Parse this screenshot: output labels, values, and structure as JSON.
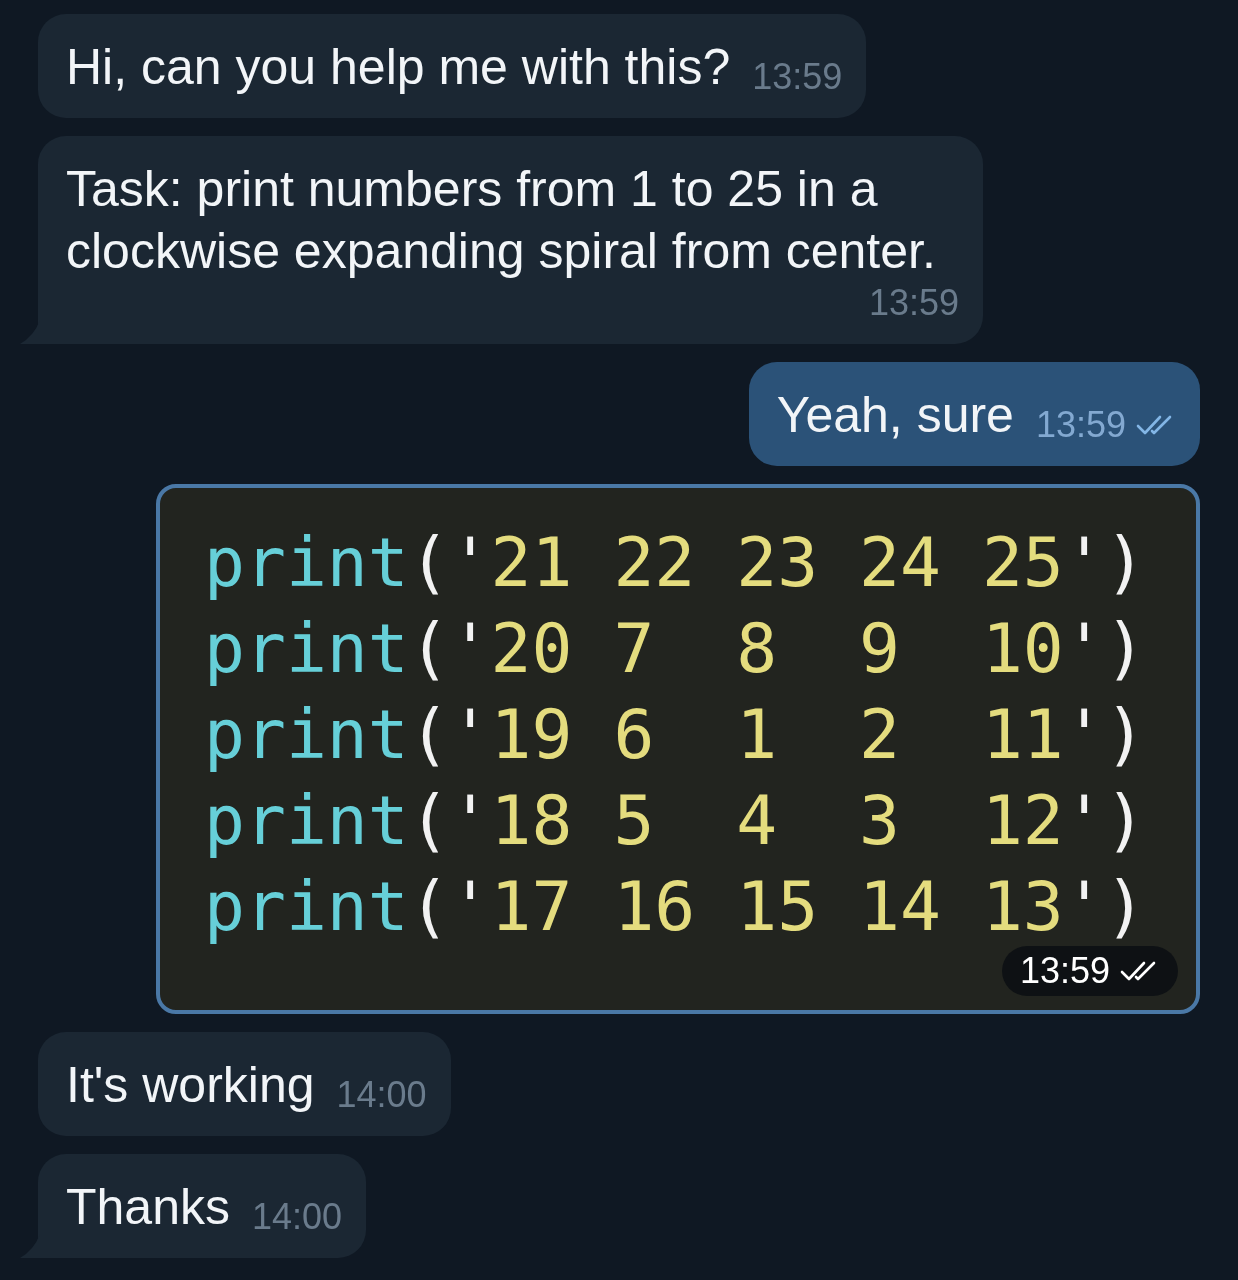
{
  "messages": [
    {
      "kind": "text",
      "outgoing": false,
      "text": "Hi, can you help me with this?",
      "time": "13:59",
      "tail": false
    },
    {
      "kind": "text",
      "outgoing": false,
      "text": "Task: print numbers from 1 to 25 in a clockwise expanding spiral from center.",
      "time": "13:59",
      "tail": true
    },
    {
      "kind": "text",
      "outgoing": true,
      "text": "Yeah, sure",
      "time": "13:59",
      "read": true,
      "tail": false
    },
    {
      "kind": "code",
      "outgoing": true,
      "time": "13:59",
      "read": true,
      "lines": [
        [
          {
            "text": "print",
            "kind": "function"
          },
          {
            "text": "(",
            "kind": "punct"
          },
          {
            "text": "'",
            "kind": "punct"
          },
          {
            "text": "21 22 23 24 25",
            "kind": "string"
          },
          {
            "text": "'",
            "kind": "punct"
          },
          {
            "text": ")",
            "kind": "punct"
          }
        ],
        [
          {
            "text": "print",
            "kind": "function"
          },
          {
            "text": "(",
            "kind": "punct"
          },
          {
            "text": "'",
            "kind": "punct"
          },
          {
            "text": "20 7  8  9  10",
            "kind": "string"
          },
          {
            "text": "'",
            "kind": "punct"
          },
          {
            "text": ")",
            "kind": "punct"
          }
        ],
        [
          {
            "text": "print",
            "kind": "function"
          },
          {
            "text": "(",
            "kind": "punct"
          },
          {
            "text": "'",
            "kind": "punct"
          },
          {
            "text": "19 6  1  2  11",
            "kind": "string"
          },
          {
            "text": "'",
            "kind": "punct"
          },
          {
            "text": ")",
            "kind": "punct"
          }
        ],
        [
          {
            "text": "print",
            "kind": "function"
          },
          {
            "text": "(",
            "kind": "punct"
          },
          {
            "text": "'",
            "kind": "punct"
          },
          {
            "text": "18 5  4  3  12",
            "kind": "string"
          },
          {
            "text": "'",
            "kind": "punct"
          },
          {
            "text": ")",
            "kind": "punct"
          }
        ],
        [
          {
            "text": "print",
            "kind": "function"
          },
          {
            "text": "(",
            "kind": "punct"
          },
          {
            "text": "'",
            "kind": "punct"
          },
          {
            "text": "17 16 15 14 13",
            "kind": "string"
          },
          {
            "text": "'",
            "kind": "punct"
          },
          {
            "text": ")",
            "kind": "punct"
          }
        ]
      ]
    },
    {
      "kind": "text",
      "outgoing": false,
      "text": "It's working",
      "time": "14:00",
      "tail": false
    },
    {
      "kind": "text",
      "outgoing": false,
      "text": "Thanks",
      "time": "14:00",
      "tail": true
    }
  ]
}
